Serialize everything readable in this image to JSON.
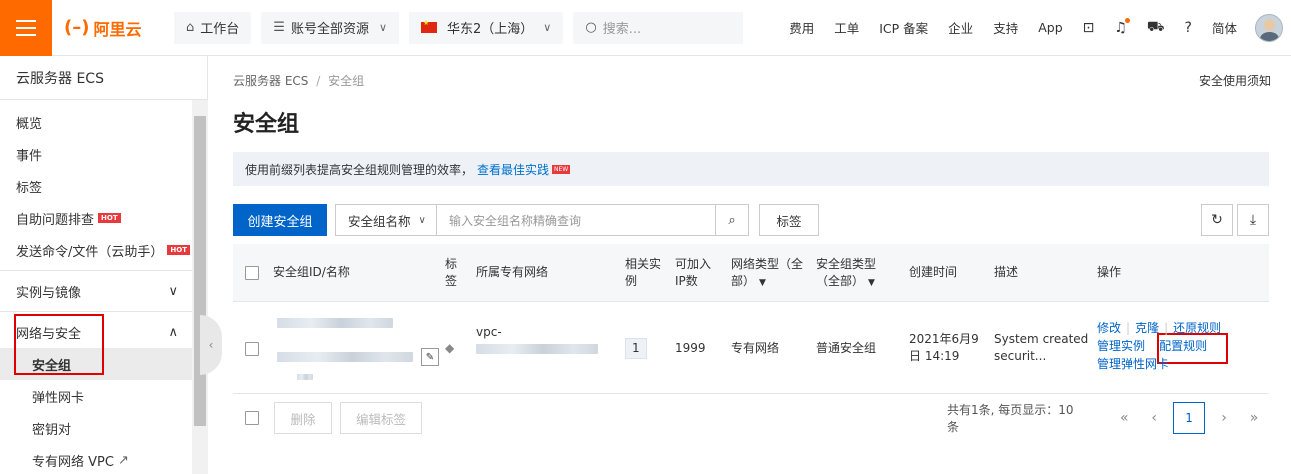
{
  "topbar": {
    "logo_text": "阿里云",
    "workbench": "工作台",
    "resources": "账号全部资源",
    "region": "华东2（上海）",
    "search_placeholder": "搜索...",
    "nav": [
      "费用",
      "工单",
      "ICP 备案",
      "企业",
      "支持",
      "App"
    ],
    "lang": "简体"
  },
  "sidebar": {
    "title": "云服务器 ECS",
    "items": [
      "概览",
      "事件",
      "标签",
      "自助问题排查",
      "发送命令/文件（云助手）"
    ],
    "hot": "HOT",
    "group_instances": "实例与镜像",
    "group_network": "网络与安全",
    "sub_items": [
      "安全组",
      "弹性网卡",
      "密钥对",
      "专有网络 VPC"
    ]
  },
  "main": {
    "breadcrumb_root": "云服务器 ECS",
    "breadcrumb_sep": "/",
    "breadcrumb_current": "安全组",
    "help_link": "安全使用须知",
    "title": "安全组",
    "notice_text": "使用前缀列表提高安全组规则管理的效率，",
    "notice_link": "查看最佳实践",
    "notice_badge": "NEW",
    "create_button": "创建安全组",
    "filter_select": "安全组名称",
    "search_placeholder": "输入安全组名称精确查询",
    "tag_button": "标签"
  },
  "table": {
    "headers": {
      "id_name": "安全组ID/名称",
      "tag": "标签",
      "vpc": "所属专有网络",
      "instances": "相关实例",
      "available_ip": "可加入IP数",
      "network_type": "网络类型（全部）",
      "sg_type": "安全组类型（全部）",
      "created": "创建时间",
      "desc": "描述",
      "actions": "操作"
    },
    "row": {
      "vpc_prefix": "vpc-",
      "instances": "1",
      "available_ip": "1999",
      "network_type": "专有网络",
      "sg_type": "普通安全组",
      "created_1": "2021年6月9",
      "created_2": "日 14:19",
      "desc_1": "System created",
      "desc_2": "securit...",
      "actions": {
        "modify": "修改",
        "clone": "克隆",
        "restore": "还原规则",
        "manage_instance": "管理实例",
        "config_rules": "配置规则",
        "manage_eni": "管理弹性网卡"
      }
    }
  },
  "footer": {
    "delete": "删除",
    "edit_tags": "编辑标签",
    "summary": "共有1条, 每页显示：10条",
    "current_page": "1"
  }
}
